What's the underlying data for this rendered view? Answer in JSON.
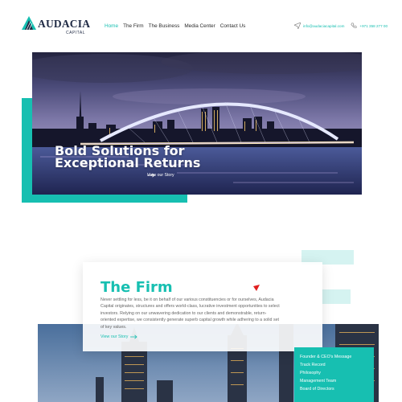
{
  "brand": {
    "name": "AUDACIA",
    "tagline": "CAPITAL",
    "accent_color": "#17bfb1",
    "dark_color": "#1f2a44"
  },
  "nav": {
    "items": [
      {
        "label": "Home",
        "active": true
      },
      {
        "label": "The Firm",
        "active": false
      },
      {
        "label": "The Business",
        "active": false
      },
      {
        "label": "Media Center",
        "active": false
      },
      {
        "label": "Contact Us",
        "active": false
      }
    ]
  },
  "contact": {
    "email": "info@audaciacapital.com",
    "email_icon": "send-icon",
    "phone": "+971 358 277 00",
    "phone_icon": "phone-icon"
  },
  "hero": {
    "title_line1": "Bold Solutions for",
    "title_line2": "Exceptional Returns",
    "cta_label": "View our Story",
    "cta_icon": "arrow-right-icon"
  },
  "firm": {
    "title": "The Firm",
    "body": "Never settling for less, be it on behalf of our various constituencies or for ourselves, Audacia Capital originates, structures and offers world-class, lucrative investment opportunities to select investors. Relying on our unwavering dedication to our clients and demonstrable, return-oriented expertise, we consistently generate superb capital growth while adhering to a solid set of key values.",
    "link_label": "View our Story",
    "link_icon": "arrow-right-icon"
  },
  "firm_menu": {
    "items": [
      "Founder & CEO's Message",
      "Track Record",
      "Philosophy",
      "Management Team",
      "Board of Directors"
    ]
  }
}
